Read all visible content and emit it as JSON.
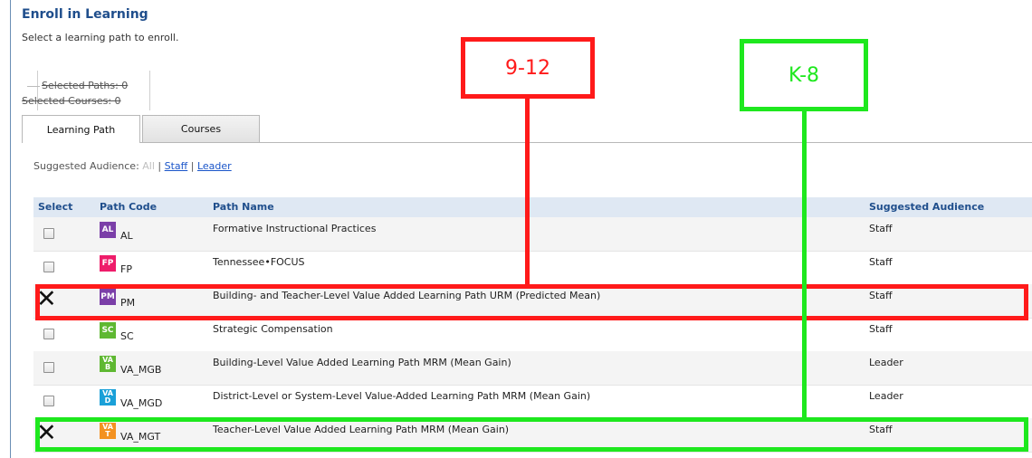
{
  "header": {
    "title": "Enroll in Learning",
    "subtitle": "Select a learning path to enroll."
  },
  "selection": {
    "paths": "Selected Paths: 0",
    "courses": "Selected Courses: 0"
  },
  "tabs": [
    {
      "label": "Learning Path",
      "active": true
    },
    {
      "label": "Courses",
      "active": false
    }
  ],
  "audience_filter": {
    "label": "Suggested Audience:",
    "all": "All",
    "sep": "|",
    "staff": "Staff",
    "leader": "Leader"
  },
  "table": {
    "headers": [
      "Select",
      "Path Code",
      "Path Name",
      "Suggested Audience"
    ],
    "rows": [
      {
        "badge": "AL",
        "badge_color": "#7b3fa8",
        "code": "AL",
        "name": "Formative Instructional Practices",
        "audience": "Staff",
        "marked": false
      },
      {
        "badge": "FP",
        "badge_color": "#ee1c6a",
        "code": "FP",
        "name": "Tennessee•FOCUS",
        "audience": "Staff",
        "marked": false
      },
      {
        "badge": "PM",
        "badge_color": "#7b3fa8",
        "code": "PM",
        "name": "Building- and Teacher-Level Value Added Learning Path URM (Predicted Mean)",
        "audience": "Staff",
        "marked": true
      },
      {
        "badge": "SC",
        "badge_color": "#5fb832",
        "code": "SC",
        "name": "Strategic Compensation",
        "audience": "Staff",
        "marked": false
      },
      {
        "badge": "VA B",
        "badge_color": "#5fb832",
        "code": "VA_MGB",
        "name": "Building-Level Value Added Learning Path MRM (Mean Gain)",
        "audience": "Leader",
        "marked": false
      },
      {
        "badge": "VA D",
        "badge_color": "#1aa0d8",
        "code": "VA_MGD",
        "name": "District-Level or System-Level Value-Added Learning Path MRM (Mean Gain)",
        "audience": "Leader",
        "marked": false
      },
      {
        "badge": "VA T",
        "badge_color": "#f39221",
        "code": "VA_MGT",
        "name": "Teacher-Level Value Added Learning Path MRM (Mean Gain)",
        "audience": "Staff",
        "marked": true
      }
    ]
  },
  "annotations": {
    "red_label": "9-12",
    "green_label": "K-8",
    "red_color": "#ff1a1a",
    "green_color": "#1ee81e"
  }
}
